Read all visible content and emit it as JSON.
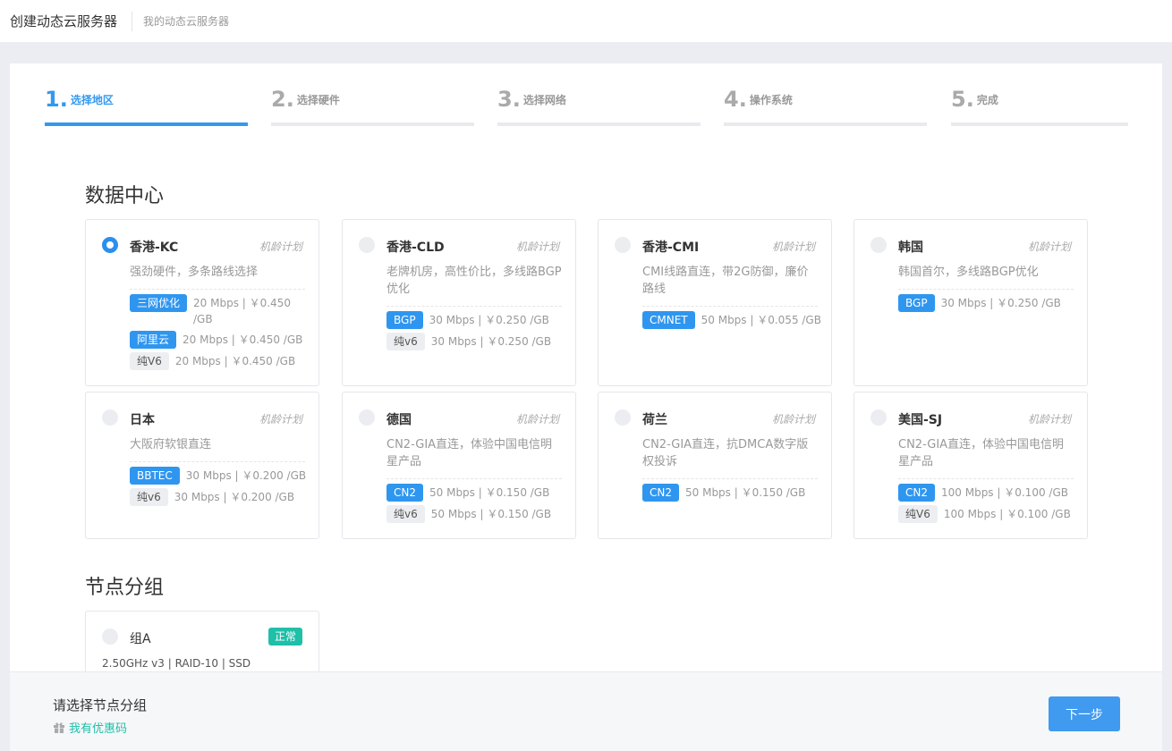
{
  "topbar": {
    "title": "创建动态云服务器",
    "link": "我的动态云服务器"
  },
  "steps": [
    {
      "num": "1.",
      "label": "选择地区",
      "active": true
    },
    {
      "num": "2.",
      "label": "选择硬件",
      "active": false
    },
    {
      "num": "3.",
      "label": "选择网络",
      "active": false
    },
    {
      "num": "4.",
      "label": "操作系统",
      "active": false
    },
    {
      "num": "5.",
      "label": "完成",
      "active": false
    }
  ],
  "datacenter": {
    "title": "数据中心",
    "plan_label": "机龄计划",
    "cards": [
      {
        "name": "香港-KC",
        "desc": "强劲硬件，多条路线选择",
        "selected": true,
        "tags": [
          {
            "label": "三网优化",
            "style": "blue",
            "info": "20 Mbps | ￥0.450 /GB"
          },
          {
            "label": "阿里云",
            "style": "blue",
            "info": "20 Mbps | ￥0.450 /GB"
          },
          {
            "label": "纯V6",
            "style": "gray",
            "info": "20 Mbps | ￥0.450 /GB"
          }
        ]
      },
      {
        "name": "香港-CLD",
        "desc": "老牌机房，高性价比，多线路BGP优化",
        "selected": false,
        "tags": [
          {
            "label": "BGP",
            "style": "blue",
            "info": "30 Mbps | ￥0.250 /GB"
          },
          {
            "label": "纯v6",
            "style": "gray",
            "info": "30 Mbps | ￥0.250 /GB"
          }
        ]
      },
      {
        "name": "香港-CMI",
        "desc": "CMI线路直连，带2G防御，廉价路线",
        "selected": false,
        "tags": [
          {
            "label": "CMNET",
            "style": "blue",
            "info": "50 Mbps | ￥0.055 /GB"
          }
        ]
      },
      {
        "name": "韩国",
        "desc": "韩国首尔，多线路BGP优化",
        "selected": false,
        "tags": [
          {
            "label": "BGP",
            "style": "blue",
            "info": "30 Mbps | ￥0.250 /GB"
          }
        ]
      },
      {
        "name": "日本",
        "desc": "大阪府软银直连",
        "selected": false,
        "tags": [
          {
            "label": "BBTEC",
            "style": "blue",
            "info": "30 Mbps | ￥0.200 /GB"
          },
          {
            "label": "纯v6",
            "style": "gray",
            "info": "30 Mbps | ￥0.200 /GB"
          }
        ]
      },
      {
        "name": "德国",
        "desc": "CN2-GIA直连，体验中国电信明星产品",
        "selected": false,
        "tags": [
          {
            "label": "CN2",
            "style": "blue",
            "info": "50 Mbps | ￥0.150 /GB"
          },
          {
            "label": "纯v6",
            "style": "gray",
            "info": "50 Mbps | ￥0.150 /GB"
          }
        ]
      },
      {
        "name": "荷兰",
        "desc": "CN2-GIA直连，抗DMCA数字版权投诉",
        "selected": false,
        "tags": [
          {
            "label": "CN2",
            "style": "blue",
            "info": "50 Mbps | ￥0.150 /GB"
          }
        ]
      },
      {
        "name": "美国-SJ",
        "desc": "CN2-GIA直连，体验中国电信明星产品",
        "selected": false,
        "tags": [
          {
            "label": "CN2",
            "style": "blue",
            "info": "100 Mbps | ￥0.100 /GB"
          },
          {
            "label": "纯V6",
            "style": "gray",
            "info": "100 Mbps | ￥0.100 /GB"
          }
        ]
      }
    ]
  },
  "node_group": {
    "title": "节点分组",
    "name": "组A",
    "badge": "正常",
    "spec": "2.50GHz v3 | RAID-10 | SSD"
  },
  "footer": {
    "status": "请选择节点分组",
    "coupon": "我有优惠码",
    "next": "下一步"
  },
  "colors": {
    "accent": "#3399f0",
    "tag_blue": "#2f96f0",
    "success": "#1fbfa8"
  }
}
